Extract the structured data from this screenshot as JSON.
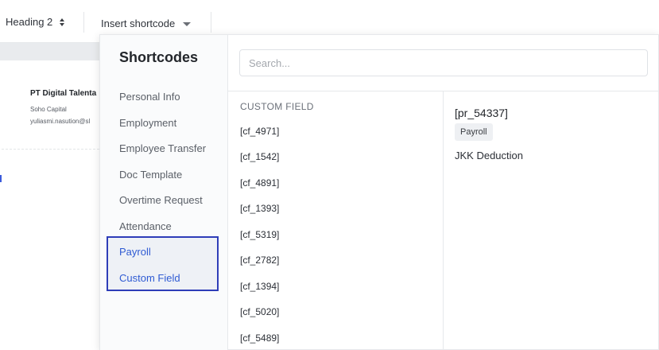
{
  "toolbar": {
    "heading_label": "Heading 2",
    "insert_label": "Insert shortcode"
  },
  "document": {
    "company_name": "PT Digital Talenta",
    "company_sub": "Soho Capital",
    "company_email": "yuliasmi.nasution@sl"
  },
  "shortcodes": {
    "title": "Shortcodes",
    "search": {
      "placeholder": "Search...",
      "value": ""
    },
    "categories": [
      {
        "label": "Personal Info"
      },
      {
        "label": "Employment"
      },
      {
        "label": "Employee Transfer"
      },
      {
        "label": "Doc Template"
      },
      {
        "label": "Overtime Request"
      },
      {
        "label": "Attendance"
      },
      {
        "label": "Payroll"
      },
      {
        "label": "Custom Field"
      }
    ],
    "field_group_heading": "CUSTOM FIELD",
    "fields": [
      "[cf_4971]",
      "[cf_1542]",
      "[cf_4891]",
      "[cf_1393]",
      "[cf_5319]",
      "[cf_2782]",
      "[cf_1394]",
      "[cf_5020]",
      "[cf_5489]"
    ],
    "detail": {
      "code": "[pr_54337]",
      "badge": "Payroll",
      "description": "JKK Deduction"
    }
  },
  "colors": {
    "accent": "#2f5bd3",
    "highlight_border": "#2e3db8"
  }
}
